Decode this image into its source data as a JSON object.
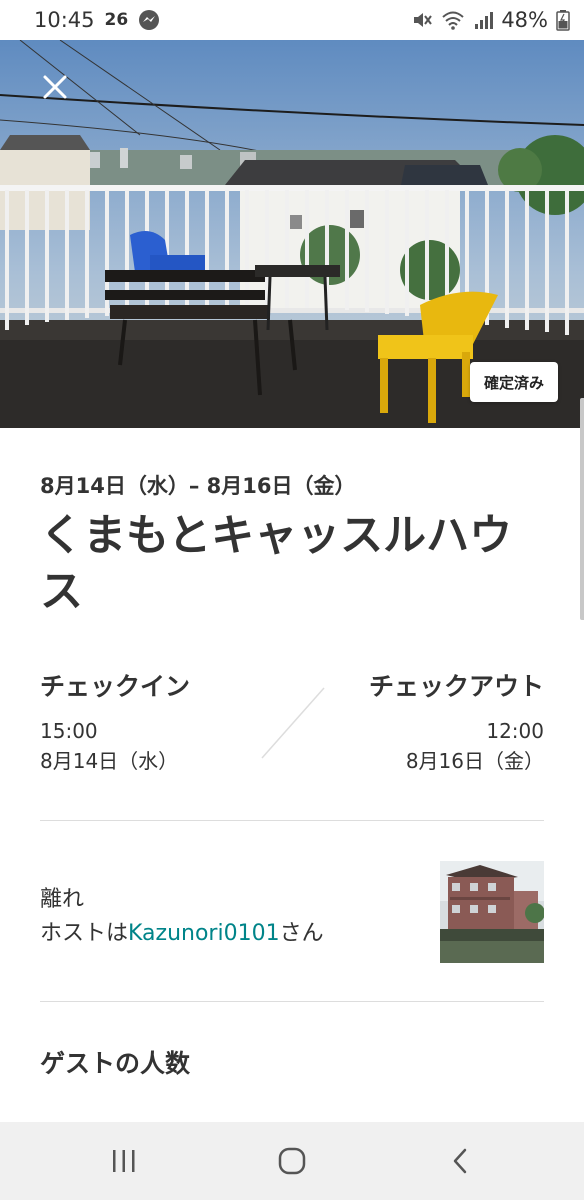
{
  "status_bar": {
    "time": "10:45",
    "notification": "26",
    "battery": "48%"
  },
  "hero": {
    "badge": "確定済み"
  },
  "trip": {
    "dates": "8月14日（水）– 8月16日（金）",
    "title": "くまもとキャッスルハウス"
  },
  "checkin": {
    "label": "チェックイン",
    "time": "15:00",
    "date": "8月14日（水）"
  },
  "checkout": {
    "label": "チェックアウト",
    "time": "12:00",
    "date": "8月16日（金）"
  },
  "host": {
    "type": "離れ",
    "prefix": "ホストは",
    "name": "Kazunori0101",
    "suffix": "さん"
  },
  "guests": {
    "title": "ゲストの人数"
  },
  "colors": {
    "link": "#008489",
    "divider": "#dddddd",
    "nav_bg": "#f0f0f0"
  },
  "icons": {
    "close": "close-icon",
    "recents": "recents-icon",
    "home": "home-icon",
    "back": "back-icon"
  }
}
